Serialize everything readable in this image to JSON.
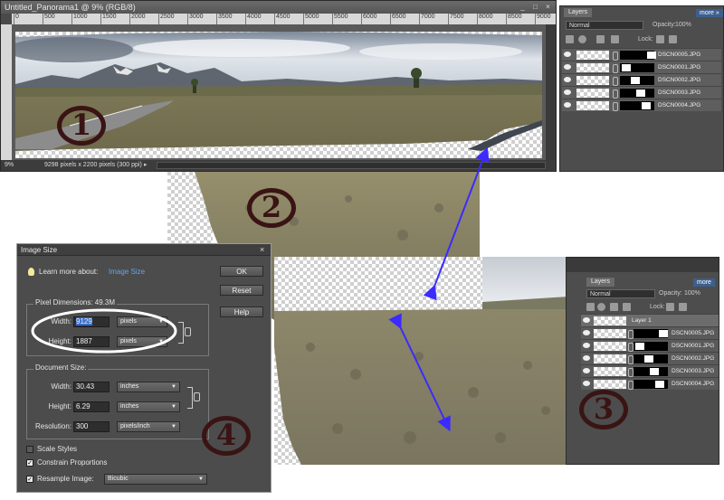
{
  "document_window": {
    "title": "Untitled_Panorama1 @ 9% (RGB/8)",
    "controls": [
      "_",
      "□",
      "×"
    ],
    "ruler_labels": [
      "0",
      "500",
      "1000",
      "1500",
      "2000",
      "2500",
      "3000",
      "3500",
      "4000",
      "4500",
      "5000",
      "5500",
      "6000",
      "6500",
      "7000",
      "7500",
      "8000",
      "8500",
      "9000"
    ],
    "zoom": "9%",
    "status_info": "9298 pixels x 2200 pixels (300 ppi)"
  },
  "layers_panel_top": {
    "tab_label": "Layers",
    "more_label": "more »",
    "blend_mode": "Normal",
    "opacity_label": "Opacity:",
    "opacity_value": "100%",
    "lock_label": "Lock:",
    "layers": [
      {
        "name": "DSCN0005.JPG"
      },
      {
        "name": "DSCN0001.JPG"
      },
      {
        "name": "DSCN0002.JPG"
      },
      {
        "name": "DSCN0003.JPG"
      },
      {
        "name": "DSCN0004.JPG"
      }
    ]
  },
  "layers_panel_right": {
    "tab_label": "Layers",
    "more_label": "more",
    "blend_mode": "Normal",
    "opacity_label": "Opacity:",
    "opacity_value": "100%",
    "lock_label": "Lock:",
    "layers": [
      {
        "name": "Layer 1"
      },
      {
        "name": "DSCN0005.JPG"
      },
      {
        "name": "DSCN0001.JPG"
      },
      {
        "name": "DSCN0002.JPG"
      },
      {
        "name": "DSCN0003.JPG"
      },
      {
        "name": "DSCN0004.JPG"
      }
    ]
  },
  "image_size_dialog": {
    "title": "Image Size",
    "learn_more_prefix": "Learn more about:",
    "learn_more_link": "Image Size",
    "ok_label": "OK",
    "reset_label": "Reset",
    "help_label": "Help",
    "pixel_dimensions_title": "Pixel Dimensions: 49.3M",
    "width_label": "Width:",
    "width_value": "9129",
    "width_unit": "pixels",
    "height_label": "Height:",
    "height_value": "1887",
    "height_unit": "pixels",
    "document_size_title": "Document Size:",
    "doc_width_label": "Width:",
    "doc_width_value": "30.43",
    "doc_width_unit": "inches",
    "doc_height_label": "Height:",
    "doc_height_value": "6.29",
    "doc_height_unit": "inches",
    "resolution_label": "Resolution:",
    "resolution_value": "300",
    "resolution_unit": "pixels/inch",
    "scale_styles_label": "Scale Styles",
    "scale_styles_checked": false,
    "constrain_label": "Constrain Proportions",
    "constrain_checked": true,
    "resample_label": "Resample Image:",
    "resample_checked": true,
    "resample_method": "Bicubic"
  },
  "annotations": {
    "step1": "1",
    "step2": "2",
    "step3": "3",
    "step4": "4"
  },
  "colors": {
    "annotation_ring": "#3a1414",
    "highlight_ellipse": "#ffffff",
    "arrow": "#3b2bff",
    "link_blue": "#5aa6ff",
    "panel_bg": "#4d4d4d"
  }
}
